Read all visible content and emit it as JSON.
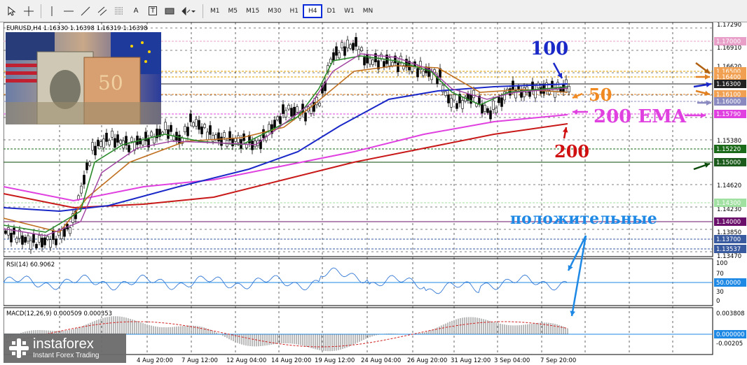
{
  "toolbar": {
    "tools": [
      "cursor-icon",
      "crosshair-icon",
      "vertical-line-icon",
      "horizontal-line-icon",
      "trendline-icon",
      "channel-icon",
      "fibonacci-icon",
      "text-icon",
      "text-label-icon",
      "rectangle-icon",
      "shapes-icon"
    ],
    "text_tool_label": "A",
    "text_label_tool": "T",
    "timeframes": [
      "M1",
      "M5",
      "M15",
      "M30",
      "H1",
      "H4",
      "D1",
      "W1",
      "MN"
    ],
    "active_timeframe": "H4"
  },
  "chart": {
    "header": "EURUSD,H4  1.16330 1.16398 1.16319 1.16398",
    "price_labels": [
      "1.17290",
      "1.16910",
      "1.16620",
      "1.16330",
      "1.15790",
      "1.15380",
      "1.14620",
      "1.14230",
      "1.13850",
      "1.13470"
    ],
    "level_labels": [
      {
        "text": "1.17000",
        "color": "#e8a0c8"
      },
      {
        "text": "1.16500",
        "color": "#f0a050"
      },
      {
        "text": "1.16400",
        "color": "#f0a050"
      },
      {
        "text": "1.16300",
        "color": "#222222"
      },
      {
        "text": "1.16100",
        "color": "#f0a050"
      },
      {
        "text": "1.16000",
        "color": "#8a8ac0"
      },
      {
        "text": "1.15790",
        "color": "#e040e0"
      },
      {
        "text": "1.15220",
        "color": "#1a6a1a"
      },
      {
        "text": "1.15000",
        "color": "#1a5a1a"
      },
      {
        "text": "1.14300",
        "color": "#a0e0a0"
      },
      {
        "text": "1.14000",
        "color": "#6a106a"
      },
      {
        "text": "1.13700",
        "color": "#3a5aa0"
      },
      {
        "text": "1.13537",
        "color": "#3a5aa0"
      }
    ],
    "time_labels": [
      "4 Aug 20:00",
      "7 Aug 12:00",
      "12 Aug 04:00",
      "14 Aug 20:00",
      "19 Aug 12:00",
      "24 Aug 04:00",
      "26 Aug 20:00",
      "31 Aug 12:00",
      "3 Sep 04:00",
      "7 Sep 20:00"
    ],
    "annotations": {
      "ma100": "100",
      "ma50": "50",
      "ema200": "200 EMA",
      "ma200": "200",
      "positive": "положительные"
    },
    "colors": {
      "ma100": "#1a28c8",
      "ma50": "#f08a20",
      "ema200": "#e040e0",
      "ma200": "#d01010",
      "positive": "#1e88e5"
    }
  },
  "rsi": {
    "header": "RSI(14) 60.9062",
    "levels": [
      "100",
      "70",
      "50.0000",
      "30",
      "0"
    ]
  },
  "macd": {
    "header": "MACD(12,26,9) 0.000509 0.000353",
    "levels": [
      "0.003808",
      "0.000000",
      "-0.00205"
    ]
  },
  "logo": {
    "name": "instaforex",
    "tagline": "Instant Forex Trading"
  }
}
